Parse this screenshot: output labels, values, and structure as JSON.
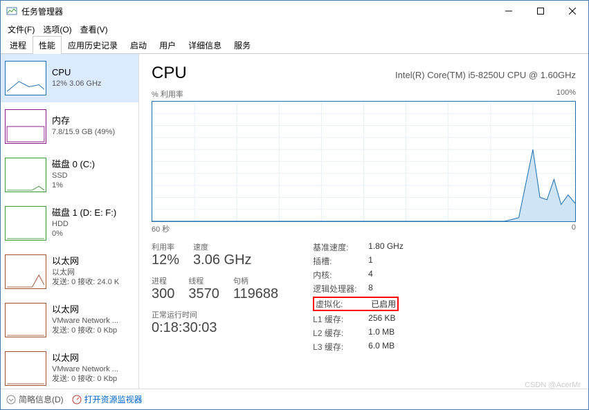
{
  "window": {
    "title": "任务管理器",
    "menus": [
      "文件(F)",
      "选项(O)",
      "查看(V)"
    ],
    "tabs": [
      "进程",
      "性能",
      "应用历史记录",
      "启动",
      "用户",
      "详细信息",
      "服务"
    ],
    "activeTab": 1
  },
  "sidebar": [
    {
      "name": "CPU",
      "sub": "12% 3.06 GHz",
      "color": "#1a6fb0"
    },
    {
      "name": "内存",
      "sub": "7.8/15.9 GB (49%)",
      "color": "#8b1a8b"
    },
    {
      "name": "磁盘 0 (C:)",
      "sub": "SSD",
      "sub2": "1%",
      "color": "#3a9b35"
    },
    {
      "name": "磁盘 1 (D: E: F:)",
      "sub": "HDD",
      "sub2": "0%",
      "color": "#3a9b35"
    },
    {
      "name": "以太网",
      "sub": "以太网",
      "sub2": "发送: 0 接收: 24.0 K",
      "color": "#a0522d"
    },
    {
      "name": "以太网",
      "sub": "VMware Network ...",
      "sub2": "发送: 0 接收: 0 Kbp",
      "color": "#a0522d"
    },
    {
      "name": "以太网",
      "sub": "VMware Network ...",
      "sub2": "发送: 0 接收: 0 Kbp",
      "color": "#a0522d"
    }
  ],
  "main": {
    "title": "CPU",
    "model": "Intel(R) Core(TM) i5-8250U CPU @ 1.60GHz",
    "chartLabel": "% 利用率",
    "chartMax": "100%",
    "chartXLeft": "60 秒",
    "chartXRight": "0",
    "stats": {
      "util_label": "利用率",
      "util": "12%",
      "speed_label": "速度",
      "speed": "3.06 GHz",
      "proc_label": "进程",
      "proc": "300",
      "thread_label": "线程",
      "thread": "3570",
      "handle_label": "句柄",
      "handle": "119688",
      "uptime_label": "正常运行时间",
      "uptime": "0:18:30:03"
    },
    "specs": [
      {
        "k": "基准速度:",
        "v": "1.80 GHz"
      },
      {
        "k": "插槽:",
        "v": "1"
      },
      {
        "k": "内核:",
        "v": "4"
      },
      {
        "k": "逻辑处理器:",
        "v": "8"
      },
      {
        "k": "虚拟化:",
        "v": "已启用",
        "hl": true
      },
      {
        "k": "L1 缓存:",
        "v": "256 KB"
      },
      {
        "k": "L2 缓存:",
        "v": "1.0 MB"
      },
      {
        "k": "L3 缓存:",
        "v": "6.0 MB"
      }
    ]
  },
  "bottom": {
    "brief": "简略信息(D)",
    "resmon": "打开资源监视器"
  },
  "watermark": "CSDN @AcerMr",
  "chart_data": {
    "type": "line",
    "title": "% 利用率",
    "xlabel": "秒",
    "ylabel": "%",
    "xlim": [
      60,
      0
    ],
    "ylim": [
      0,
      100
    ],
    "x": [
      60,
      55,
      50,
      45,
      40,
      35,
      30,
      25,
      20,
      15,
      10,
      8,
      6,
      5,
      4,
      3,
      2,
      1,
      0
    ],
    "values": [
      0,
      0,
      0,
      0,
      0,
      0,
      0,
      0,
      0,
      0,
      0,
      3,
      60,
      20,
      18,
      35,
      14,
      22,
      15
    ]
  }
}
